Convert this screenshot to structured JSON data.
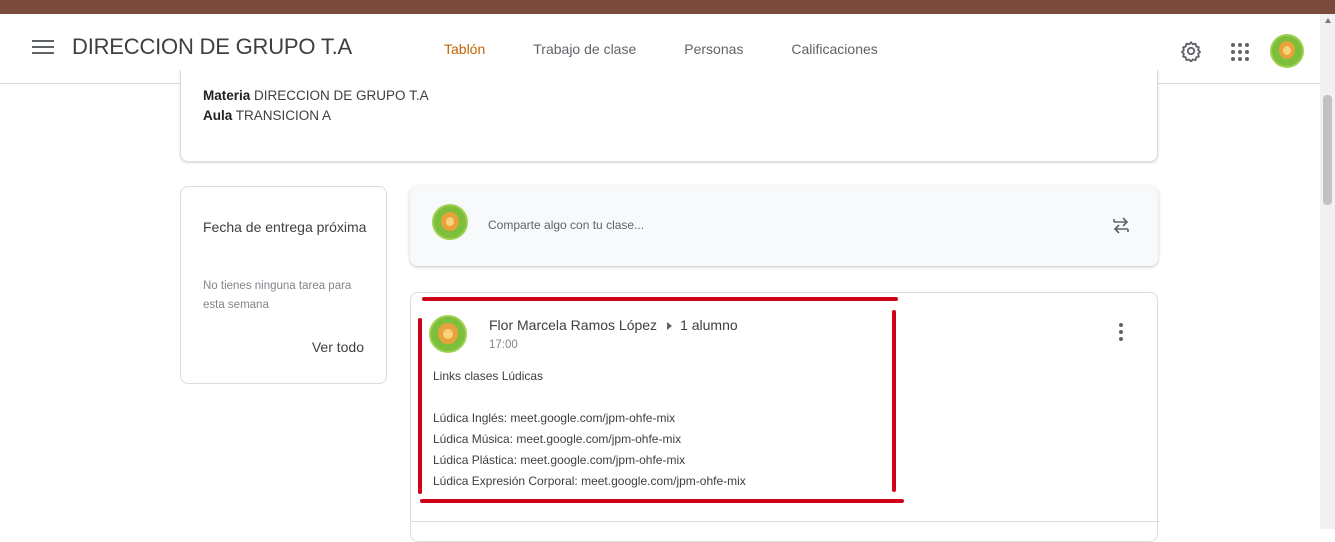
{
  "header": {
    "class_title": "DIRECCION DE GRUPO T.A",
    "tabs": [
      {
        "label": "Tablón",
        "active": true
      },
      {
        "label": "Trabajo de clase",
        "active": false
      },
      {
        "label": "Personas",
        "active": false
      },
      {
        "label": "Calificaciones",
        "active": false
      }
    ],
    "icons": [
      "menu-icon",
      "gear-icon",
      "apps-grid-icon",
      "avatar"
    ],
    "accent_color": "#c26401"
  },
  "info": {
    "subject_label": "Materia",
    "subject_value": "DIRECCION DE GRUPO T.A",
    "room_label": "Aula",
    "room_value": "TRANSICION A"
  },
  "due": {
    "title": "Fecha de entrega próxima",
    "subtitle": "No tienes ninguna tarea para esta semana",
    "link": "Ver todo"
  },
  "share": {
    "placeholder": "Comparte algo con tu clase..."
  },
  "post": {
    "author": "Flor Marcela Ramos López",
    "audience": "1 alumno",
    "time": "17:00",
    "lines": [
      "Links clases Lúdicas",
      "",
      "Lúdica Inglés: meet.google.com/jpm-ohfe-mix",
      "Lúdica Música: meet.google.com/jpm-ohfe-mix",
      "Lúdica Plástica: meet.google.com/jpm-ohfe-mix",
      "Lúdica Expresión Corporal: meet.google.com/jpm-ohfe-mix"
    ]
  },
  "annotation_color": "#d0021b"
}
